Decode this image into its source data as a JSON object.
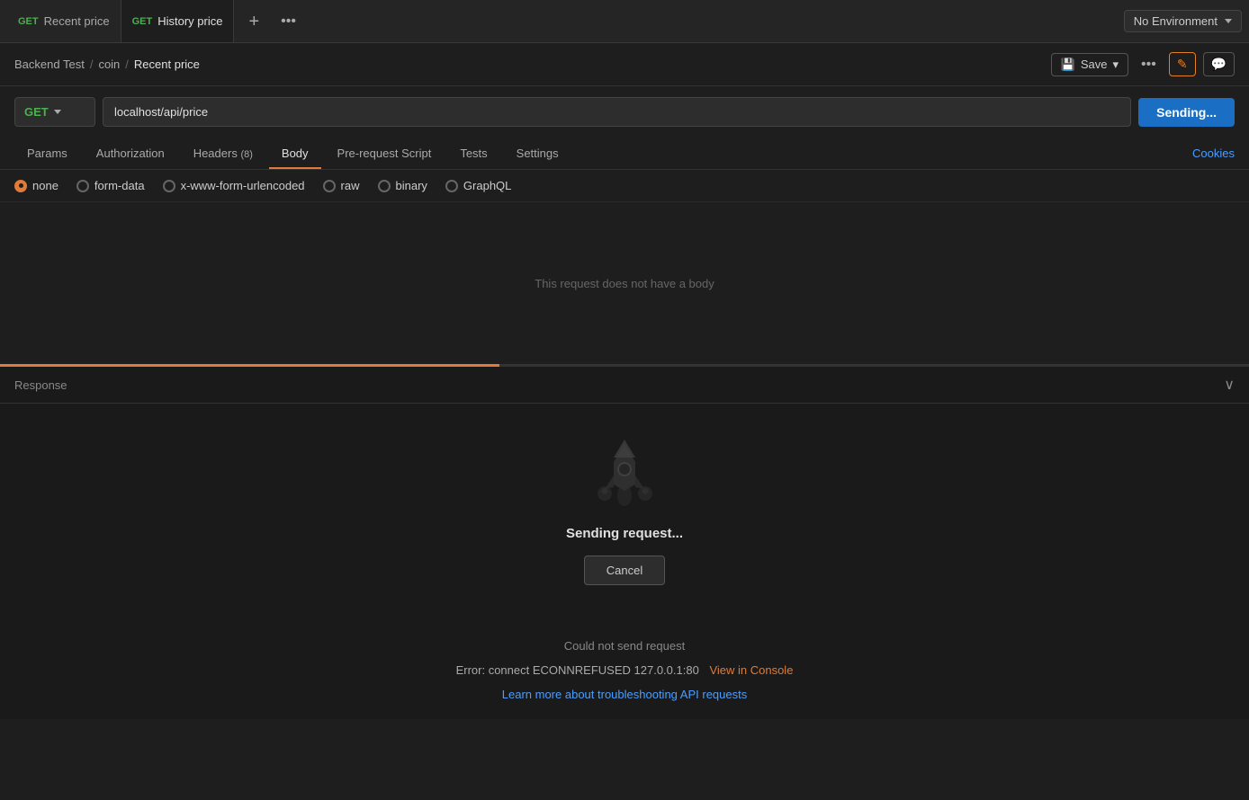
{
  "tabs": {
    "active_tab": {
      "method": "GET",
      "label": "Recent price"
    },
    "inactive_tab": {
      "method": "GET",
      "label": "History price"
    },
    "add_label": "+",
    "more_label": "•••"
  },
  "environment": {
    "label": "No Environment",
    "chevron": "▾"
  },
  "breadcrumb": {
    "part1": "Backend Test",
    "separator1": "/",
    "part2": "coin",
    "separator2": "/",
    "current": "Recent price"
  },
  "toolbar": {
    "save_label": "Save",
    "save_icon": "💾",
    "dropdown_icon": "▾",
    "more_label": "•••",
    "edit_label": "✎",
    "comment_label": "💬"
  },
  "url_bar": {
    "method": "GET",
    "url": "localhost/api/price",
    "send_label": "Sending..."
  },
  "request_tabs": {
    "params": "Params",
    "authorization": "Authorization",
    "headers": "Headers",
    "headers_count": "(8)",
    "body": "Body",
    "pre_request": "Pre-request Script",
    "tests": "Tests",
    "settings": "Settings",
    "cookies": "Cookies"
  },
  "body_options": {
    "none": "none",
    "form_data": "form-data",
    "urlencoded": "x-www-form-urlencoded",
    "raw": "raw",
    "binary": "binary",
    "graphql": "GraphQL"
  },
  "body_placeholder": "This request does not have a body",
  "response": {
    "title": "Response",
    "sending_text": "Sending request...",
    "cancel_label": "Cancel",
    "error_text": "Could not send request",
    "error_detail": "Error: connect ECONNREFUSED 127.0.0.1:80",
    "view_in_console": "View in Console",
    "learn_link": "Learn more about troubleshooting API requests"
  }
}
